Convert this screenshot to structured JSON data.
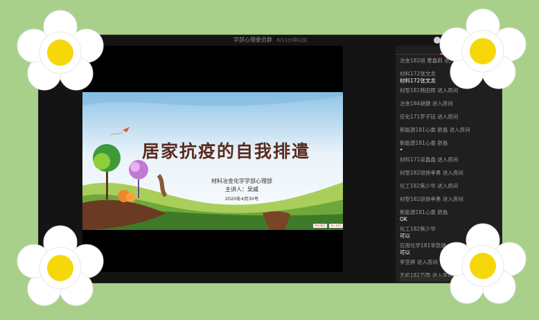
{
  "window": {
    "title": "学部心理委员群",
    "subtitle": "8/11分钟以前"
  },
  "slide": {
    "title": "居家抗疫的自我排遣",
    "department": "材料冶金化学学部心理部",
    "speaker": "主讲人：吴威",
    "date": "2020年4月30号",
    "badges": [
      "待办事项",
      "进入房间"
    ]
  },
  "chat": {
    "tab_label": "群聊",
    "messages": [
      {
        "meta": "冶金182班 曹鑫莉 进入房间",
        "content": ""
      },
      {
        "meta": "材料172张文龙",
        "content": "材料172张文龙"
      },
      {
        "meta": "材型181韩田辉 进入房间",
        "content": ""
      },
      {
        "meta": "冶金184胡健 进入房间",
        "content": ""
      },
      {
        "meta": "应化171罗子钰 进入房间",
        "content": ""
      },
      {
        "meta": "新能源181心委 舒晶 进入房间",
        "content": ""
      },
      {
        "meta": "新能源181心委 舒晶",
        "content": "•"
      },
      {
        "meta": "材料171吴鑫鑫 进入房间",
        "content": ""
      },
      {
        "meta": "材型182班徐孝勇 进入房间",
        "content": ""
      },
      {
        "meta": "化工182焦少华 进入房间",
        "content": ""
      },
      {
        "meta": "材型182班徐孝勇 进入房间",
        "content": ""
      },
      {
        "meta": "新能源181心委 舒晶",
        "content": "OK"
      },
      {
        "meta": "化工182焦少华",
        "content": "可以"
      },
      {
        "meta": "应用化学181李凯瑞",
        "content": "可以"
      },
      {
        "meta": "李亚婷 进入房间",
        "content": ""
      },
      {
        "meta": "无机182万雨 进入房间",
        "content": ""
      }
    ]
  },
  "colors": {
    "background": "#a8d08a",
    "accent": "#e8623a",
    "flower_center": "#f6d70a"
  }
}
